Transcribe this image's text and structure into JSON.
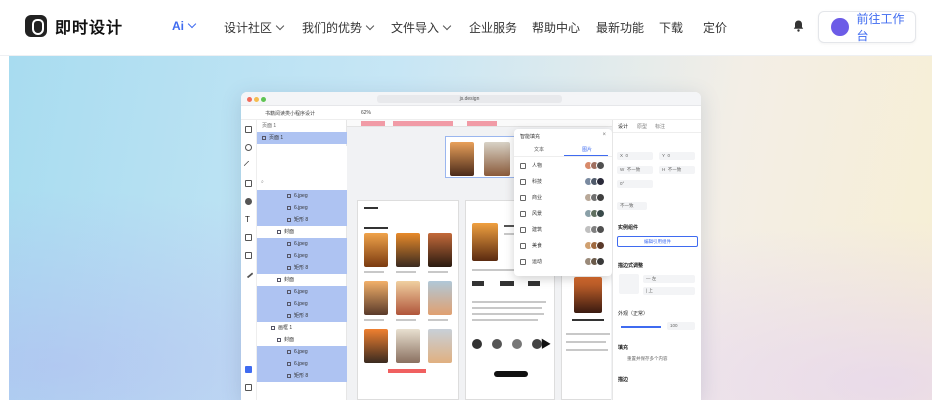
{
  "header": {
    "logo_text": "即时设计",
    "nav": [
      {
        "label": "Ai",
        "dropdown": true
      },
      {
        "label": "设计社区",
        "dropdown": true
      },
      {
        "label": "我们的优势",
        "dropdown": true
      },
      {
        "label": "文件导入",
        "dropdown": true
      },
      {
        "label": "企业服务",
        "dropdown": false
      },
      {
        "label": "帮助中心",
        "dropdown": false
      },
      {
        "label": "最新功能",
        "dropdown": false
      },
      {
        "label": "下载",
        "dropdown": false
      },
      {
        "label": "定价",
        "dropdown": false
      }
    ],
    "cta_label": "前往工作台",
    "accent": "#3f6bf0"
  },
  "app": {
    "url": "js.design",
    "project": "书籍阅读类小程序设计",
    "zoom": "62%",
    "page_label": "页面 1",
    "layers": [
      {
        "label": "页面 1",
        "selected": true
      },
      {
        "label": "6.jpeg",
        "selected": true
      },
      {
        "label": "6.jpeg",
        "selected": true
      },
      {
        "label": "矩形 8",
        "selected": true
      },
      {
        "label": "封面",
        "selected": false
      },
      {
        "label": "6.jpeg",
        "selected": true
      },
      {
        "label": "6.jpeg",
        "selected": true
      },
      {
        "label": "矩形 8",
        "selected": true
      },
      {
        "label": "封面",
        "selected": false
      },
      {
        "label": "6.jpeg",
        "selected": true
      },
      {
        "label": "6.jpeg",
        "selected": true
      },
      {
        "label": "矩形 8",
        "selected": true
      },
      {
        "label": "画框 1",
        "selected": false
      },
      {
        "label": "封面",
        "selected": false
      },
      {
        "label": "6.jpeg",
        "selected": true
      },
      {
        "label": "6.jpeg",
        "selected": true
      },
      {
        "label": "矩形 8",
        "selected": true
      }
    ],
    "ai_panel": {
      "title": "智能填充",
      "tabs": [
        "文本",
        "图片"
      ],
      "categories": [
        "人物",
        "科技",
        "商业",
        "风景",
        "建筑",
        "美食",
        "运动"
      ]
    },
    "right_panel": {
      "tabs": [
        "设计",
        "原型",
        "标注"
      ],
      "fields": [
        "X",
        "0",
        "Y",
        "0",
        "W",
        "不一致",
        "H",
        "不一致"
      ],
      "section_instance": "实例组件",
      "edit_button": "编辑引用组件",
      "section_layout": "描边式调整",
      "section_appearance": "外观（正常）",
      "opacity": "100",
      "section_fill": "填充",
      "fill_note": "重置并保存多个内容",
      "section_stroke": "描边"
    }
  }
}
